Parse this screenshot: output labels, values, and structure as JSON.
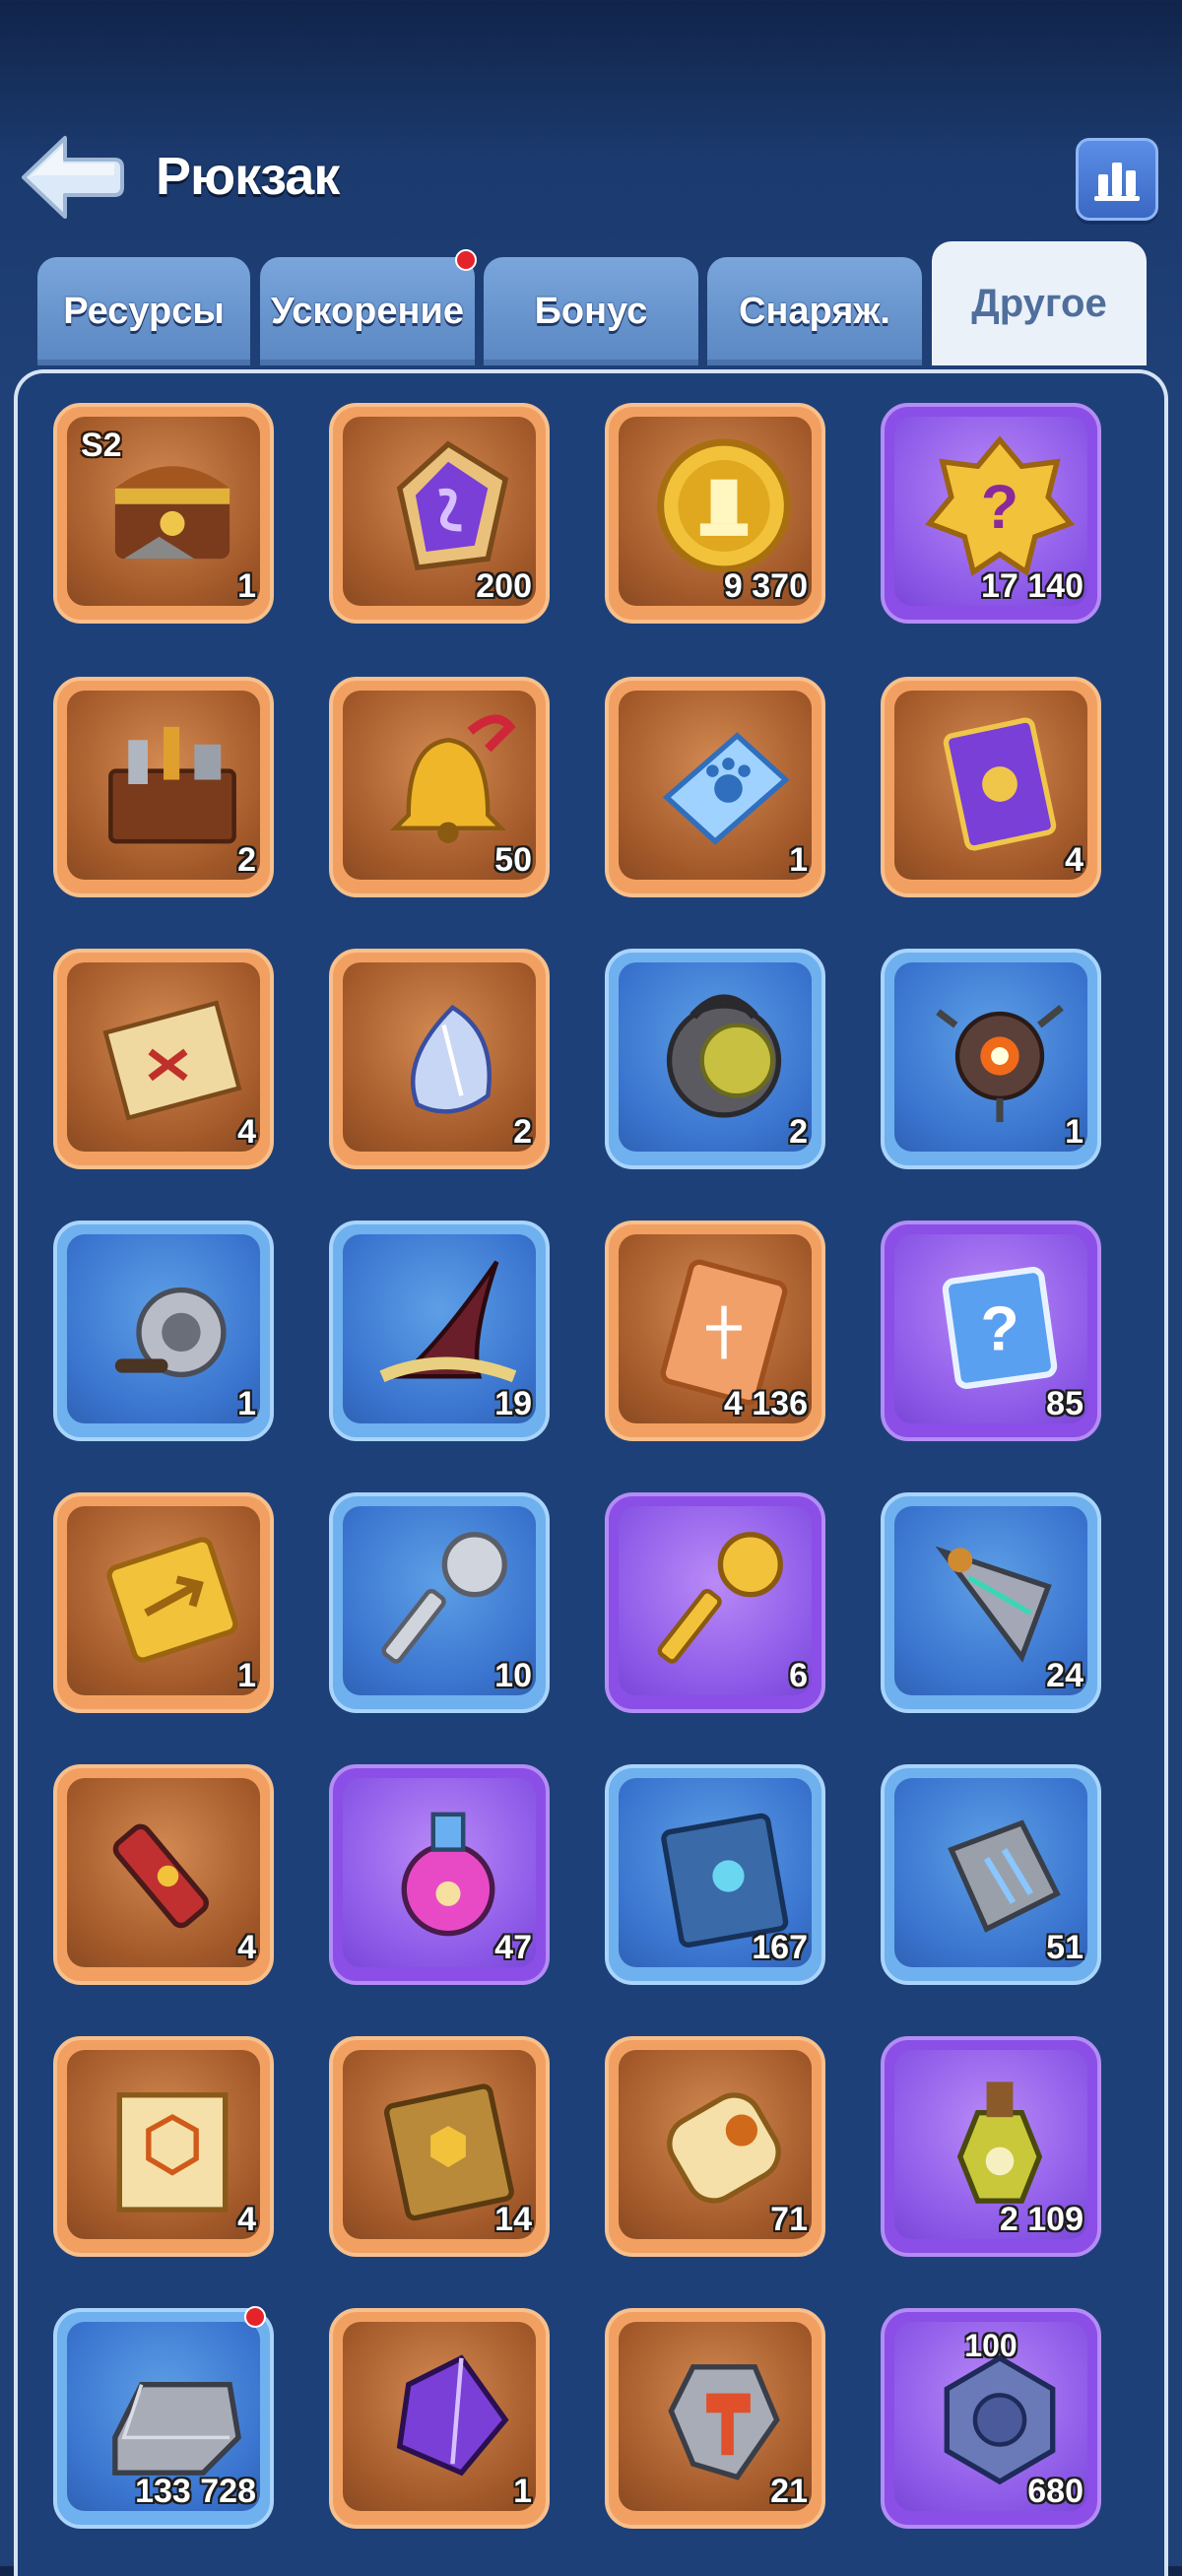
{
  "header": {
    "title": "Рюкзак"
  },
  "tabs": [
    {
      "label": "Ресурсы",
      "active": false,
      "notification": false
    },
    {
      "label": "Ускорение",
      "active": false,
      "notification": true
    },
    {
      "label": "Бонус",
      "active": false,
      "notification": false
    },
    {
      "label": "Снаряж.",
      "active": false,
      "notification": false
    },
    {
      "label": "Другое",
      "active": true,
      "notification": false
    }
  ],
  "items": [
    {
      "icon": "season-2-treasure-chest-icon",
      "count": "1",
      "rarity": "orange",
      "badge": "S2"
    },
    {
      "icon": "purple-rune-shard-icon",
      "count": "200",
      "rarity": "orange"
    },
    {
      "icon": "gold-trophy-coin-icon",
      "count": "9 370",
      "rarity": "orange"
    },
    {
      "icon": "mystery-gold-badge-icon",
      "count": "17 140",
      "rarity": "purple"
    },
    {
      "icon": "toolbox-icon",
      "count": "2",
      "rarity": "orange"
    },
    {
      "icon": "golden-bell-icon",
      "count": "50",
      "rarity": "orange"
    },
    {
      "icon": "paw-ticket-icon",
      "count": "1",
      "rarity": "orange"
    },
    {
      "icon": "purple-card-icon",
      "count": "4",
      "rarity": "orange"
    },
    {
      "icon": "treasure-map-scroll-icon",
      "count": "4",
      "rarity": "orange"
    },
    {
      "icon": "crystal-shell-icon",
      "count": "2",
      "rarity": "orange"
    },
    {
      "icon": "diving-helmet-icon",
      "count": "2",
      "rarity": "blue"
    },
    {
      "icon": "robot-drone-icon",
      "count": "1",
      "rarity": "blue"
    },
    {
      "icon": "fishing-reel-icon",
      "count": "1",
      "rarity": "blue"
    },
    {
      "icon": "beast-horn-icon",
      "count": "19",
      "rarity": "blue"
    },
    {
      "icon": "scales-ticket-icon",
      "count": "4 136",
      "rarity": "orange"
    },
    {
      "icon": "mystery-card-icon",
      "count": "85",
      "rarity": "purple"
    },
    {
      "icon": "gold-arrow-ticket-icon",
      "count": "1",
      "rarity": "orange"
    },
    {
      "icon": "silver-key-icon",
      "count": "10",
      "rarity": "blue"
    },
    {
      "icon": "gold-key-icon",
      "count": "6",
      "rarity": "purple"
    },
    {
      "icon": "spear-tip-icon",
      "count": "24",
      "rarity": "blue"
    },
    {
      "icon": "paw-syringe-icon",
      "count": "4",
      "rarity": "orange"
    },
    {
      "icon": "paw-potion-icon",
      "count": "47",
      "rarity": "purple"
    },
    {
      "icon": "paw-book-icon",
      "count": "167",
      "rarity": "blue"
    },
    {
      "icon": "claw-stone-icon",
      "count": "51",
      "rarity": "blue"
    },
    {
      "icon": "hexagon-scroll-icon",
      "count": "4",
      "rarity": "orange"
    },
    {
      "icon": "hexagon-book-icon",
      "count": "14",
      "rarity": "orange"
    },
    {
      "icon": "sealed-scroll-icon",
      "count": "71",
      "rarity": "orange"
    },
    {
      "icon": "bottle-potion-icon",
      "count": "2 109",
      "rarity": "purple"
    },
    {
      "icon": "silver-ingot-icon",
      "count": "133 728",
      "rarity": "blue",
      "notification": true
    },
    {
      "icon": "purple-crystal-icon",
      "count": "1",
      "rarity": "orange"
    },
    {
      "icon": "hammer-stone-icon",
      "count": "21",
      "rarity": "orange"
    },
    {
      "icon": "hex-nut-icon",
      "count": "680",
      "rarity": "purple",
      "topnum": "100"
    }
  ]
}
